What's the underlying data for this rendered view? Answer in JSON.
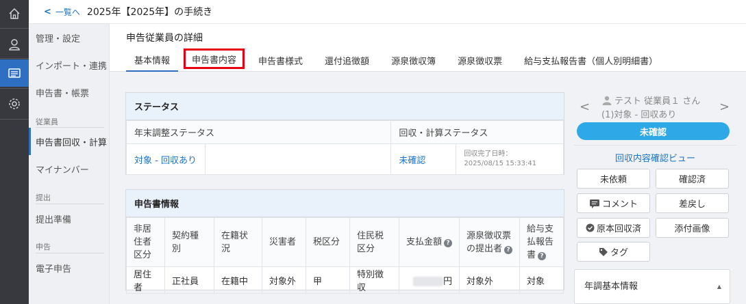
{
  "topbar": {
    "back_label": "一覧へ",
    "title": "2025年【2025年】の手続き"
  },
  "sidenav": {
    "items": [
      "管理・設定",
      "インポート・連携",
      "申告書・帳票"
    ],
    "cat_employee": "従業員",
    "employee_items": [
      "申告書回収・計算",
      "マイナンバー"
    ],
    "cat_submit": "提出",
    "submit_items": [
      "提出準備"
    ],
    "cat_declare": "申告",
    "declare_items": [
      "電子申告"
    ]
  },
  "main": {
    "subtitle": "申告従業員の詳細",
    "tabs": [
      "基本情報",
      "申告書内容",
      "申告書様式",
      "還付追徴額",
      "源泉徴収簿",
      "源泉徴収票",
      "給与支払報告書（個人別明細書）"
    ]
  },
  "status_card": {
    "title": "ステータス",
    "col1_header": "年末調整ステータス",
    "col2_header": "回収・計算ステータス",
    "col1_value": "対象 - 回収あり",
    "col2_value": "未確認",
    "completed_label": "回収完了日時：",
    "completed_value": "2025/08/15 15:33:41"
  },
  "app_card": {
    "title": "申告書情報",
    "headers": [
      "非居住者区分",
      "契約種別",
      "在籍状況",
      "災害者",
      "税区分",
      "住民税区分",
      "支払金額",
      "源泉徴収票の提出者",
      "給与支払報告書"
    ],
    "values": [
      "居住者",
      "正社員",
      "在籍中",
      "対象外",
      "甲",
      "特別徴収",
      "円",
      "対象外",
      "対象"
    ]
  },
  "right_panel": {
    "employee_name": "テスト 従業員１ さん",
    "employee_status": "(1)対象 - 回収あり",
    "status_pill": "未確認",
    "review_link": "回収内容確認ビュー",
    "buttons": {
      "not_requested": "未依頼",
      "confirmed": "確認済",
      "comment": "コメント",
      "send_back": "差戻し",
      "original_collected": "原本回収済",
      "attached_image": "添付画像",
      "tag": "タグ"
    },
    "section_label": "年調基本情報"
  },
  "colors": {
    "accent": "#2f6fc2",
    "pill": "#2ea8e6",
    "highlight": "#e60012",
    "rail": "#37393f"
  }
}
